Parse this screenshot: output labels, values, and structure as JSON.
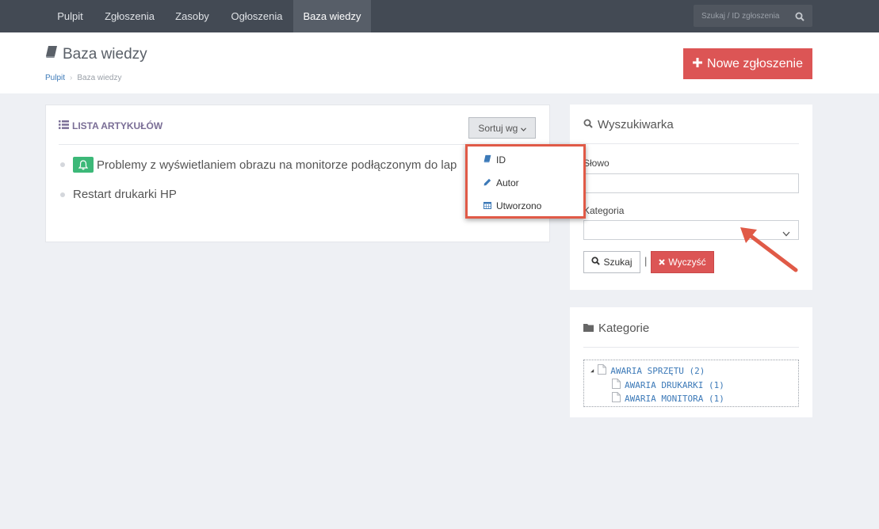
{
  "nav": {
    "items": [
      {
        "label": "Pulpit"
      },
      {
        "label": "Zgłoszenia"
      },
      {
        "label": "Zasoby"
      },
      {
        "label": "Ogłoszenia"
      },
      {
        "label": "Baza wiedzy",
        "active": true
      }
    ],
    "search_placeholder": "Szukaj / ID zgłoszenia"
  },
  "header": {
    "title": "Baza wiedzy",
    "breadcrumb": [
      "Pulpit",
      "Baza wiedzy"
    ],
    "new_button": "Nowe zgłoszenie"
  },
  "articles": {
    "title": "LISTA ARTYKUŁÓW",
    "sort_label": "Sortuj wg",
    "sort_options": [
      {
        "label": "ID",
        "icon": "book-icon"
      },
      {
        "label": "Autor",
        "icon": "pencil-icon"
      },
      {
        "label": "Utworzono",
        "icon": "calendar-icon"
      }
    ],
    "items": [
      {
        "title": "Problemy z wyświetlaniem obrazu na monitorze podłączonym do lap",
        "badge_icon": "bell-icon"
      },
      {
        "title": "Restart drukarki HP"
      }
    ]
  },
  "search": {
    "title": "Wyszukiwarka",
    "word_label": "Słowo",
    "word_value": "",
    "category_label": "Kategoria",
    "category_value": "",
    "search_button": "Szukaj",
    "separator": "|",
    "clear_button": "Wyczyść"
  },
  "categories": {
    "title": "Kategorie",
    "tree": [
      {
        "label": "AWARIA SPRZĘTU (2)",
        "children": [
          {
            "label": "AWARIA DRUKARKI (1)"
          },
          {
            "label": "AWARIA MONITORA (1)"
          }
        ]
      }
    ]
  },
  "colors": {
    "nav_bg": "#434a54",
    "accent_red": "#dc5555",
    "link_blue": "#3d7ab8",
    "badge_green": "#3cb878",
    "annotation_red": "#e05a47"
  }
}
